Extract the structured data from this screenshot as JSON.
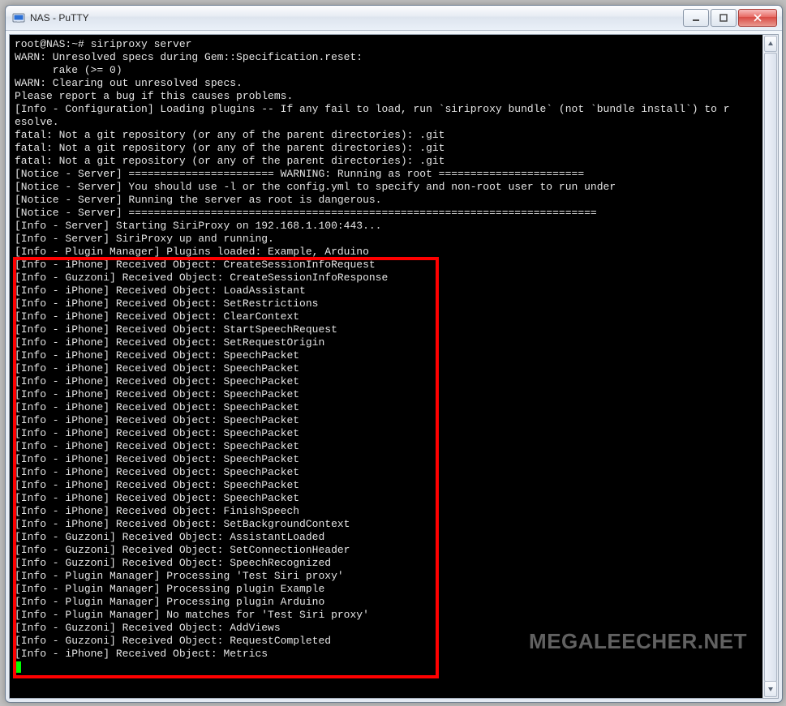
{
  "window": {
    "title": "NAS - PuTTY",
    "app_icon_name": "putty-icon"
  },
  "watermark": "MEGALEECHER.NET",
  "pre_lines": [
    "root@NAS:~# siriproxy server",
    "WARN: Unresolved specs during Gem::Specification.reset:",
    "      rake (>= 0)",
    "WARN: Clearing out unresolved specs.",
    "Please report a bug if this causes problems.",
    "[Info - Configuration] Loading plugins -- If any fail to load, run `siriproxy bundle` (not `bundle install`) to r",
    "esolve.",
    "fatal: Not a git repository (or any of the parent directories): .git",
    "fatal: Not a git repository (or any of the parent directories): .git",
    "fatal: Not a git repository (or any of the parent directories): .git",
    "[Notice - Server] ======================= WARNING: Running as root =======================",
    "[Notice - Server] You should use -l or the config.yml to specify and non-root user to run under",
    "[Notice - Server] Running the server as root is dangerous.",
    "[Notice - Server] ==========================================================================",
    "[Info - Server] Starting SiriProxy on 192.168.1.100:443...",
    "[Info - Server] SiriProxy up and running.",
    "[Info - Plugin Manager] Plugins loaded: Example, Arduino"
  ],
  "boxed_lines": [
    "[Info - iPhone] Received Object: CreateSessionInfoRequest",
    "[Info - Guzzoni] Received Object: CreateSessionInfoResponse",
    "[Info - iPhone] Received Object: LoadAssistant",
    "[Info - iPhone] Received Object: SetRestrictions",
    "[Info - iPhone] Received Object: ClearContext",
    "[Info - iPhone] Received Object: StartSpeechRequest",
    "[Info - iPhone] Received Object: SetRequestOrigin",
    "[Info - iPhone] Received Object: SpeechPacket",
    "[Info - iPhone] Received Object: SpeechPacket",
    "[Info - iPhone] Received Object: SpeechPacket",
    "[Info - iPhone] Received Object: SpeechPacket",
    "[Info - iPhone] Received Object: SpeechPacket",
    "[Info - iPhone] Received Object: SpeechPacket",
    "[Info - iPhone] Received Object: SpeechPacket",
    "[Info - iPhone] Received Object: SpeechPacket",
    "[Info - iPhone] Received Object: SpeechPacket",
    "[Info - iPhone] Received Object: SpeechPacket",
    "[Info - iPhone] Received Object: SpeechPacket",
    "[Info - iPhone] Received Object: SpeechPacket",
    "[Info - iPhone] Received Object: FinishSpeech",
    "[Info - iPhone] Received Object: SetBackgroundContext",
    "[Info - Guzzoni] Received Object: AssistantLoaded",
    "[Info - Guzzoni] Received Object: SetConnectionHeader",
    "[Info - Guzzoni] Received Object: SpeechRecognized",
    "[Info - Plugin Manager] Processing 'Test Siri proxy'",
    "[Info - Plugin Manager] Processing plugin Example",
    "[Info - Plugin Manager] Processing plugin Arduino",
    "[Info - Plugin Manager] No matches for 'Test Siri proxy'",
    "[Info - Guzzoni] Received Object: AddViews",
    "[Info - Guzzoni] Received Object: RequestCompleted",
    "[Info - iPhone] Received Object: Metrics"
  ]
}
